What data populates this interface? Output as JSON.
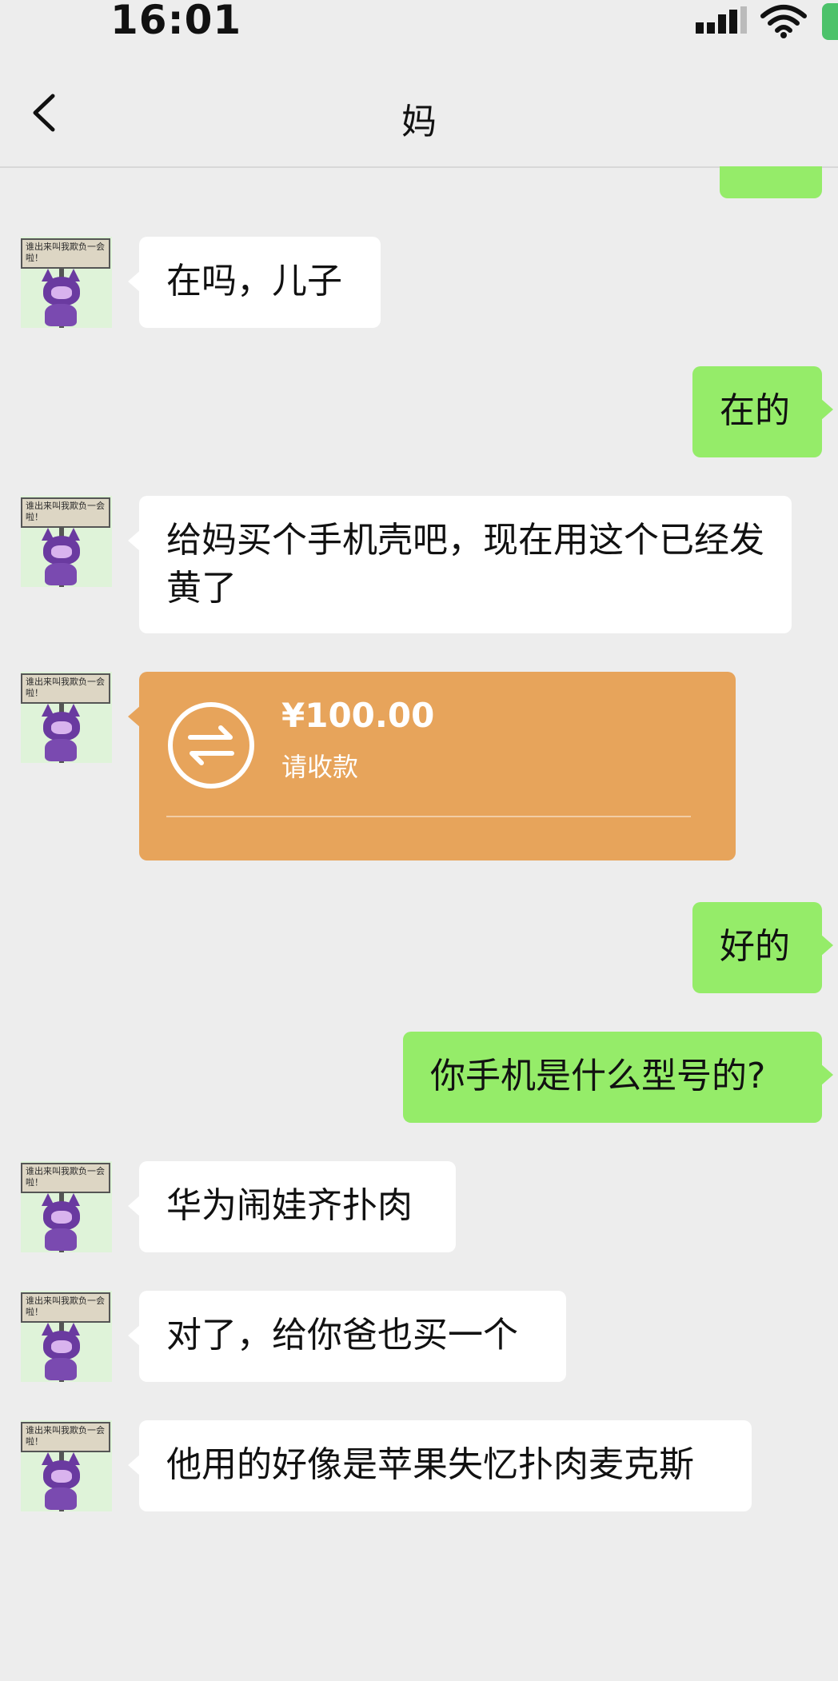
{
  "status_bar": {
    "time": "16:01"
  },
  "header": {
    "title": "妈"
  },
  "avatar": {
    "sign_text": "谁出来叫我欺负一会啦！"
  },
  "messages": [
    {
      "side": "left",
      "text": "在吗，儿子"
    },
    {
      "side": "right",
      "text": "在的"
    },
    {
      "side": "left",
      "text": "给妈买个手机壳吧，现在用这个已经发黄了"
    },
    {
      "side": "left",
      "type": "transfer",
      "amount": "¥100.00",
      "status": "请收款"
    },
    {
      "side": "right",
      "text": "好的"
    },
    {
      "side": "right",
      "text": "你手机是什么型号的?"
    },
    {
      "side": "left",
      "text": "华为闹娃齐扑肉"
    },
    {
      "side": "left",
      "text": "对了，给你爸也买一个"
    },
    {
      "side": "left",
      "text": "他用的好像是苹果失忆扑肉麦克斯"
    }
  ],
  "colors": {
    "self_bubble": "#95ec69",
    "other_bubble": "#ffffff",
    "transfer_card": "#e7a45b",
    "background": "#ededed"
  },
  "icons": {
    "back": "chevron-left-icon",
    "transfer": "transfer-arrows-icon",
    "signal": "signal-icon",
    "wifi": "wifi-icon",
    "battery": "battery-icon"
  }
}
